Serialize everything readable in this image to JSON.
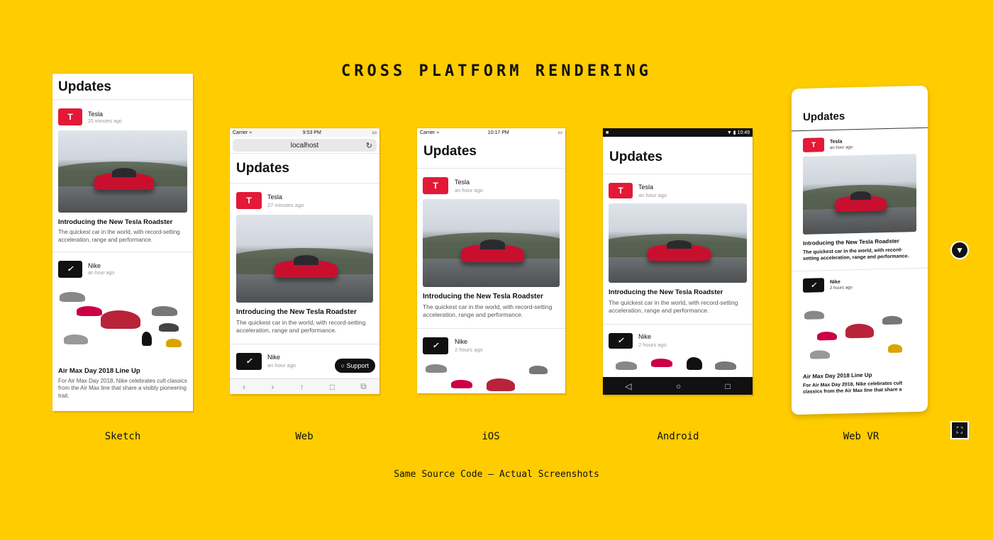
{
  "title": "CROSS PLATFORM RENDERING",
  "subtitle": "Same Source Code – Actual Screenshots",
  "platform_labels": {
    "sketch": "Sketch",
    "web": "Web",
    "ios": "iOS",
    "android": "Android",
    "webvr": "Web VR"
  },
  "common": {
    "heading": "Updates",
    "tesla": "Tesla",
    "nike": "Nike",
    "tesla_logo": "T",
    "nike_logo": "✓",
    "tesla_title": "Introducing the New Tesla Roadster",
    "tesla_body": "The quickest car in the world, with record-setting acceleration, range and performance.",
    "nike_title": "Air Max Day 2018 Line Up",
    "nike_body": "For Air Max Day 2018, Nike celebrates cult classics from the Air Max line that share a visibly pioneering trait."
  },
  "sketch": {
    "tesla_time": "25 minutes ago",
    "nike_time": "an hour ago"
  },
  "web": {
    "status": {
      "carrier": "Carrier ≈",
      "time": "9:53 PM",
      "battery": "▭"
    },
    "url": "localhost",
    "reload_icon": "↻",
    "tesla_time": "27 minutes ago",
    "nike_time": "an hour ago",
    "support": "○ Support",
    "dock": [
      "‹",
      "›",
      "↑",
      "□",
      "⧉"
    ]
  },
  "ios": {
    "status": {
      "carrier": "Carrier ≈",
      "time": "10:17 PM",
      "battery": "▭"
    },
    "tesla_time": "an hour ago",
    "nike_time": "2 hours ago"
  },
  "android": {
    "status": {
      "left": "■",
      "time": "▼ ▮ 10:49"
    },
    "tesla_time": "an hour ago",
    "nike_time": "2 hours ago",
    "nav": [
      "◁",
      "○",
      "□"
    ]
  },
  "webvr": {
    "tesla_time": "an hour ago",
    "nike_time": "2 hours ago"
  },
  "side_icons": {
    "cardboard": "▼",
    "fullscreen": "⛶"
  },
  "colors": {
    "background": "#FFCC00",
    "tesla_red": "#E31937",
    "nike_black": "#111111"
  }
}
